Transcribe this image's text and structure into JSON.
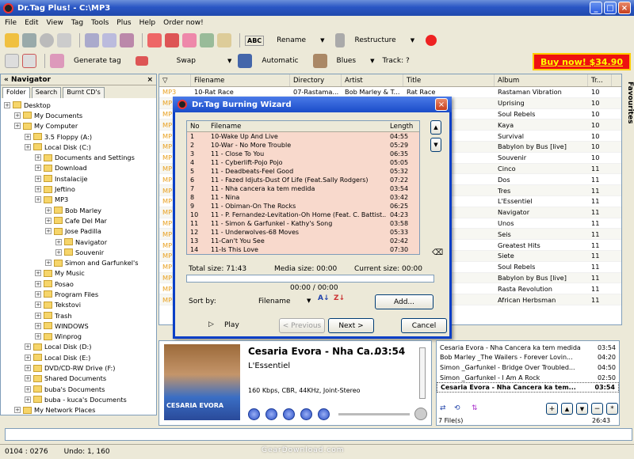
{
  "app": {
    "title": "Dr.Tag Plus! - C:\\MP3"
  },
  "menu": [
    "File",
    "Edit",
    "View",
    "Tag",
    "Tools",
    "Plus",
    "Help",
    "Order now!"
  ],
  "toolbar1": {
    "abc": "ABC",
    "rename": "Rename",
    "restructure": "Restructure"
  },
  "toolbar2": {
    "generate_tag": "Generate tag",
    "swap": "Swap",
    "automatic": "Automatic",
    "genre": "Blues",
    "track": "Track: ?"
  },
  "buynow": "Buy now! $34.90",
  "navigator": {
    "title": "« Navigator",
    "tabs": [
      "Folder",
      "Search",
      "Burnt CD's"
    ],
    "tree": [
      {
        "label": "Desktop",
        "indent": 0
      },
      {
        "label": "My Documents",
        "indent": 1
      },
      {
        "label": "My Computer",
        "indent": 1
      },
      {
        "label": "3.5 Floppy (A:)",
        "indent": 2
      },
      {
        "label": "Local Disk (C:)",
        "indent": 2
      },
      {
        "label": "Documents and Settings",
        "indent": 3
      },
      {
        "label": "Download",
        "indent": 3
      },
      {
        "label": "Instalacije",
        "indent": 3
      },
      {
        "label": "Jeftino",
        "indent": 3
      },
      {
        "label": "MP3",
        "indent": 3
      },
      {
        "label": "Bob Marley",
        "indent": 4
      },
      {
        "label": "Cafe Del Mar",
        "indent": 4
      },
      {
        "label": "Jose Padilla",
        "indent": 4
      },
      {
        "label": "Navigator",
        "indent": 5
      },
      {
        "label": "Souvenir",
        "indent": 5
      },
      {
        "label": "Simon and Garfunkel's",
        "indent": 4
      },
      {
        "label": "My Music",
        "indent": 3
      },
      {
        "label": "Posao",
        "indent": 3
      },
      {
        "label": "Program Files",
        "indent": 3
      },
      {
        "label": "Tekstovi",
        "indent": 3
      },
      {
        "label": "Trash",
        "indent": 3
      },
      {
        "label": "WINDOWS",
        "indent": 3
      },
      {
        "label": "Winprog",
        "indent": 3
      },
      {
        "label": "Local Disk (D:)",
        "indent": 2
      },
      {
        "label": "Local Disk (E:)",
        "indent": 2
      },
      {
        "label": "DVD/CD-RW Drive (F:)",
        "indent": 2
      },
      {
        "label": "Shared Documents",
        "indent": 2
      },
      {
        "label": "buba's Documents",
        "indent": 2
      },
      {
        "label": "buba - kuca's Documents",
        "indent": 2
      },
      {
        "label": "My Network Places",
        "indent": 1
      }
    ]
  },
  "grid": {
    "columns": [
      "Filename",
      "Directory",
      "Artist",
      "Title",
      "Album",
      "Tr..."
    ],
    "rows": [
      {
        "type": "MP3",
        "filename": "10-Rat Race",
        "directory": "07-Rastama...",
        "artist": "Bob Marley & T...",
        "title": "Rat Race",
        "album": "Rastaman Vibration",
        "track": "10"
      },
      {
        "type": "MP",
        "filename": "",
        "directory": "",
        "artist": "",
        "title": "",
        "album": "Uprising",
        "track": "10"
      },
      {
        "type": "MP",
        "filename": "",
        "directory": "",
        "artist": "",
        "title": "",
        "album": "Soul Rebels",
        "track": "10"
      },
      {
        "type": "MP",
        "filename": "",
        "directory": "",
        "artist": "",
        "title": "",
        "album": "Kaya",
        "track": "10"
      },
      {
        "type": "MP",
        "filename": "",
        "directory": "",
        "artist": "",
        "title": "ive",
        "album": "Survival",
        "track": "10"
      },
      {
        "type": "MP",
        "filename": "",
        "directory": "",
        "artist": "",
        "title": "Trouble",
        "album": "Babylon by Bus [live]",
        "track": "10"
      },
      {
        "type": "MP",
        "filename": "",
        "directory": "",
        "artist": "",
        "title": "",
        "album": "Souvenir",
        "track": "10"
      },
      {
        "type": "MP",
        "filename": "",
        "directory": "",
        "artist": "",
        "title": "ojo",
        "album": "Cinco",
        "track": "11"
      },
      {
        "type": "MP",
        "filename": "",
        "directory": "",
        "artist": "",
        "title": "l Good",
        "album": "Dos",
        "track": "11"
      },
      {
        "type": "MP",
        "filename": "",
        "directory": "",
        "artist": "",
        "title": "ust Of Life ...",
        "album": "Tres",
        "track": "11"
      },
      {
        "type": "MP",
        "filename": "",
        "directory": "",
        "artist": "",
        "title": "a tem medida",
        "album": "L'Essentiel",
        "track": "11"
      },
      {
        "type": "MP",
        "filename": "",
        "directory": "",
        "artist": "",
        "title": "",
        "album": "Navigator",
        "track": "11"
      },
      {
        "type": "MP",
        "filename": "",
        "directory": "",
        "artist": "",
        "title": "e Rocks",
        "album": "Unos",
        "track": "11"
      },
      {
        "type": "MP",
        "filename": "",
        "directory": "",
        "artist": "",
        "title": "ez-Levitatio...",
        "album": "Seis",
        "track": "11"
      },
      {
        "type": "MP",
        "filename": "",
        "directory": "",
        "artist": "",
        "title": "",
        "album": "Greatest Hits",
        "track": "11"
      },
      {
        "type": "MP",
        "filename": "",
        "directory": "",
        "artist": "",
        "title": "3 Moves",
        "album": "Siete",
        "track": "11"
      },
      {
        "type": "MP",
        "filename": "",
        "directory": "",
        "artist": "",
        "title": "",
        "album": "Soul Rebels",
        "track": "11"
      },
      {
        "type": "MP",
        "filename": "",
        "directory": "",
        "artist": "",
        "title": "",
        "album": "Babylon by Bus [live]",
        "track": "11"
      },
      {
        "type": "MP",
        "filename": "",
        "directory": "",
        "artist": "",
        "title": "",
        "album": "Rasta Revolution",
        "track": "11"
      },
      {
        "type": "MP",
        "filename": "",
        "directory": "",
        "artist": "",
        "title": "",
        "album": "African Herbsman",
        "track": "11"
      }
    ]
  },
  "favourites": "Favourites",
  "wizard": {
    "title": "Dr.Tag Burning Wizard",
    "columns": [
      "No",
      "Filename",
      "Length"
    ],
    "tracks": [
      {
        "no": "1",
        "filename": "10-Wake Up And Live",
        "length": "04:55"
      },
      {
        "no": "2",
        "filename": "10-War - No More Trouble",
        "length": "05:29"
      },
      {
        "no": "3",
        "filename": "11 - Close To You",
        "length": "06:35"
      },
      {
        "no": "4",
        "filename": "11 - Cyberlift-Pojo Pojo",
        "length": "05:05"
      },
      {
        "no": "5",
        "filename": "11 - Deadbeats-Feel Good",
        "length": "05:32"
      },
      {
        "no": "6",
        "filename": "11 - Fazed Idjuts-Dust Of Life (Feat.Sally Rodgers)",
        "length": "07:22"
      },
      {
        "no": "7",
        "filename": "11 - Nha cancera ka tem medida",
        "length": "03:54"
      },
      {
        "no": "8",
        "filename": "11 - Nina",
        "length": "03:42"
      },
      {
        "no": "9",
        "filename": "11 - Obiman-On The Rocks",
        "length": "06:25"
      },
      {
        "no": "10",
        "filename": "11 - P. Fernandez-Levitation-Oh Home (Feat. C. Battist...",
        "length": "04:23"
      },
      {
        "no": "11",
        "filename": "11 - Simon & Garfunkel - Kathy's Song",
        "length": "03:58"
      },
      {
        "no": "12",
        "filename": "11 - Underwolves-68 Moves",
        "length": "05:33"
      },
      {
        "no": "13",
        "filename": "11-Can't You See",
        "length": "02:42"
      },
      {
        "no": "14",
        "filename": "11-Is This Love",
        "length": "07:30"
      }
    ],
    "total_size": "Total size: 71:43",
    "media_size": "Media size: 00:00",
    "current_size": "Current size: 00:00",
    "progress": "00:00 / 00:00",
    "sort_by_label": "Sort by:",
    "sort_by_value": "Filename",
    "add_button": "Add...",
    "play_button": "Play",
    "previous_button": "< Previous",
    "next_button": "Next >",
    "cancel_button": "Cancel"
  },
  "player": {
    "now_playing": "Cesaria Evora - Nha Ca...",
    "time": "03:54",
    "album": "L'Essentiel",
    "info": "160 Kbps, CBR, 44KHz, Joint-Stereo",
    "cover_text": "CESARIA EVORA"
  },
  "playlist": {
    "items": [
      {
        "title": "Cesaria Evora - Nha Cancera ka tem medida",
        "time": "03:54"
      },
      {
        "title": "Bob Marley _The Wailers - Forever Lovin...",
        "time": "04:20"
      },
      {
        "title": "Simon _Garfunkel - Bridge Over Troubled...",
        "time": "04:50"
      },
      {
        "title": "Simon _Garfunkel - I Am A Rock",
        "time": "02:50"
      },
      {
        "title": "Cesaria Evora - Nha Cancera ka tem...",
        "time": "03:54"
      }
    ],
    "file_count": "7 File(s)",
    "total": "26:43"
  },
  "status": {
    "position": "0104 : 0276",
    "undo": "Undo: 1, 160"
  },
  "watermark": "GearDownload.com"
}
